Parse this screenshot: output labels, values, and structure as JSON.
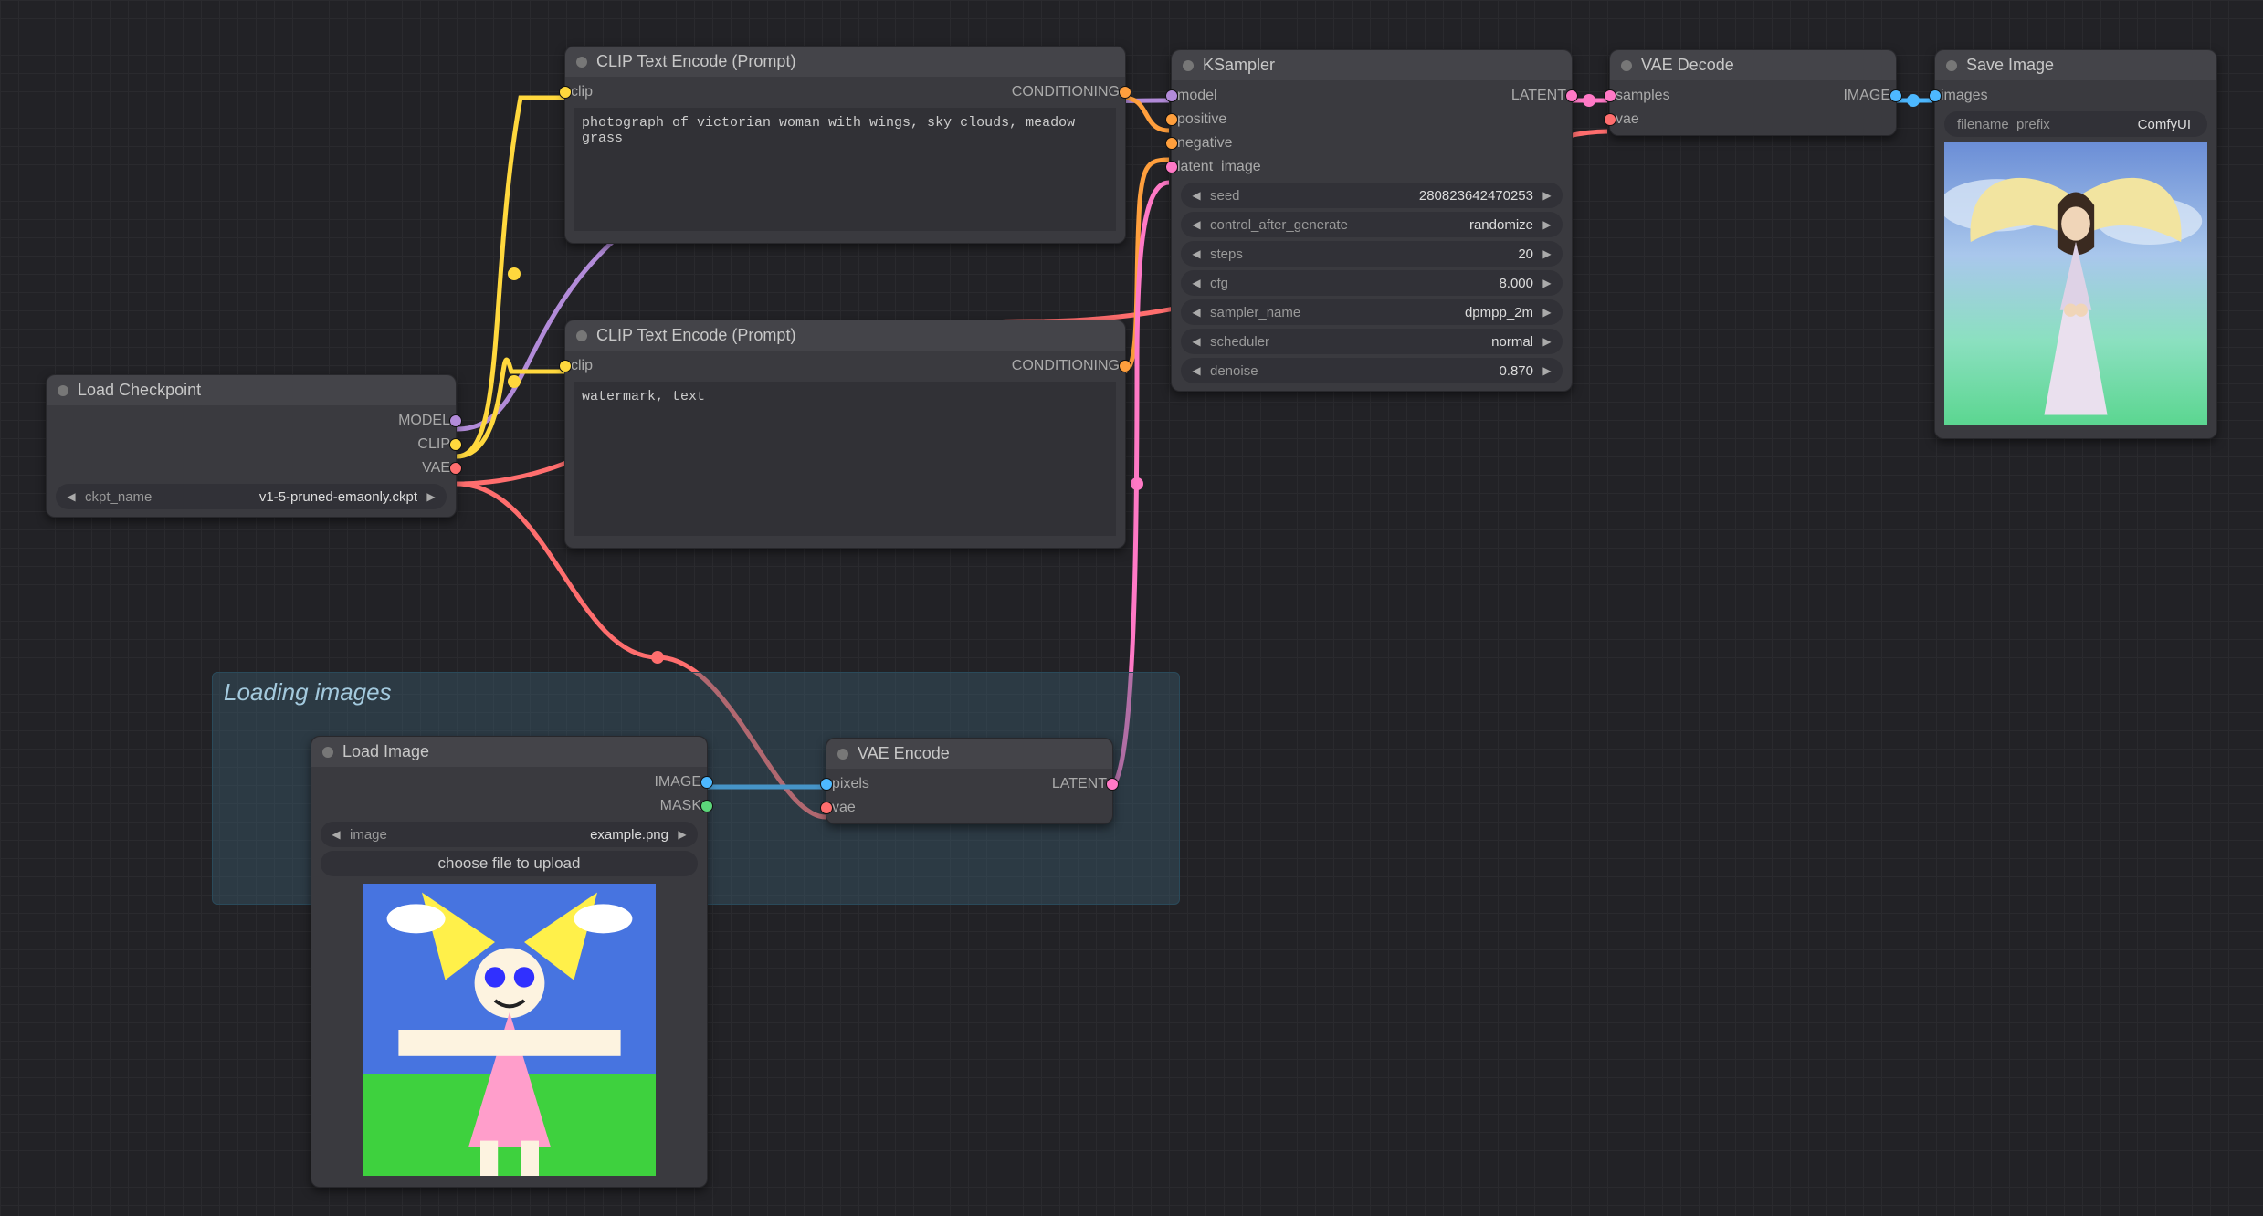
{
  "nodes": {
    "load_checkpoint": {
      "title": "Load Checkpoint",
      "outputs": {
        "model": "MODEL",
        "clip": "CLIP",
        "vae": "VAE"
      },
      "ckpt_name_label": "ckpt_name",
      "ckpt_name_value": "v1-5-pruned-emaonly.ckpt"
    },
    "clip_pos": {
      "title": "CLIP Text Encode (Prompt)",
      "input": "clip",
      "output": "CONDITIONING",
      "text": "photograph of victorian woman with wings, sky clouds, meadow grass"
    },
    "clip_neg": {
      "title": "CLIP Text Encode (Prompt)",
      "input": "clip",
      "output": "CONDITIONING",
      "text": "watermark, text"
    },
    "group": {
      "title": "Loading images"
    },
    "load_image": {
      "title": "Load Image",
      "output_image": "IMAGE",
      "output_mask": "MASK",
      "image_label": "image",
      "image_value": "example.png",
      "choose_file": "choose file to upload"
    },
    "vae_encode": {
      "title": "VAE Encode",
      "input_pixels": "pixels",
      "input_vae": "vae",
      "output": "LATENT"
    },
    "ksampler": {
      "title": "KSampler",
      "input_model": "model",
      "input_positive": "positive",
      "input_negative": "negative",
      "input_latent": "latent_image",
      "output": "LATENT",
      "widgets": {
        "seed": {
          "label": "seed",
          "value": "280823642470253"
        },
        "cag": {
          "label": "control_after_generate",
          "value": "randomize"
        },
        "steps": {
          "label": "steps",
          "value": "20"
        },
        "cfg": {
          "label": "cfg",
          "value": "8.000"
        },
        "sampler": {
          "label": "sampler_name",
          "value": "dpmpp_2m"
        },
        "sched": {
          "label": "scheduler",
          "value": "normal"
        },
        "denoise": {
          "label": "denoise",
          "value": "0.870"
        }
      }
    },
    "vae_decode": {
      "title": "VAE Decode",
      "input_samples": "samples",
      "input_vae": "vae",
      "output": "IMAGE"
    },
    "save_image": {
      "title": "Save Image",
      "input_images": "images",
      "prefix_label": "filename_prefix",
      "prefix_value": "ComfyUI"
    }
  },
  "colors": {
    "model": "#b28bd9",
    "clip": "#ffd83d",
    "vae": "#ff6e6e",
    "conditioning": "#ff9f3d",
    "latent": "#ff79c6",
    "image": "#4db8ff",
    "mask": "#5cd67a"
  }
}
